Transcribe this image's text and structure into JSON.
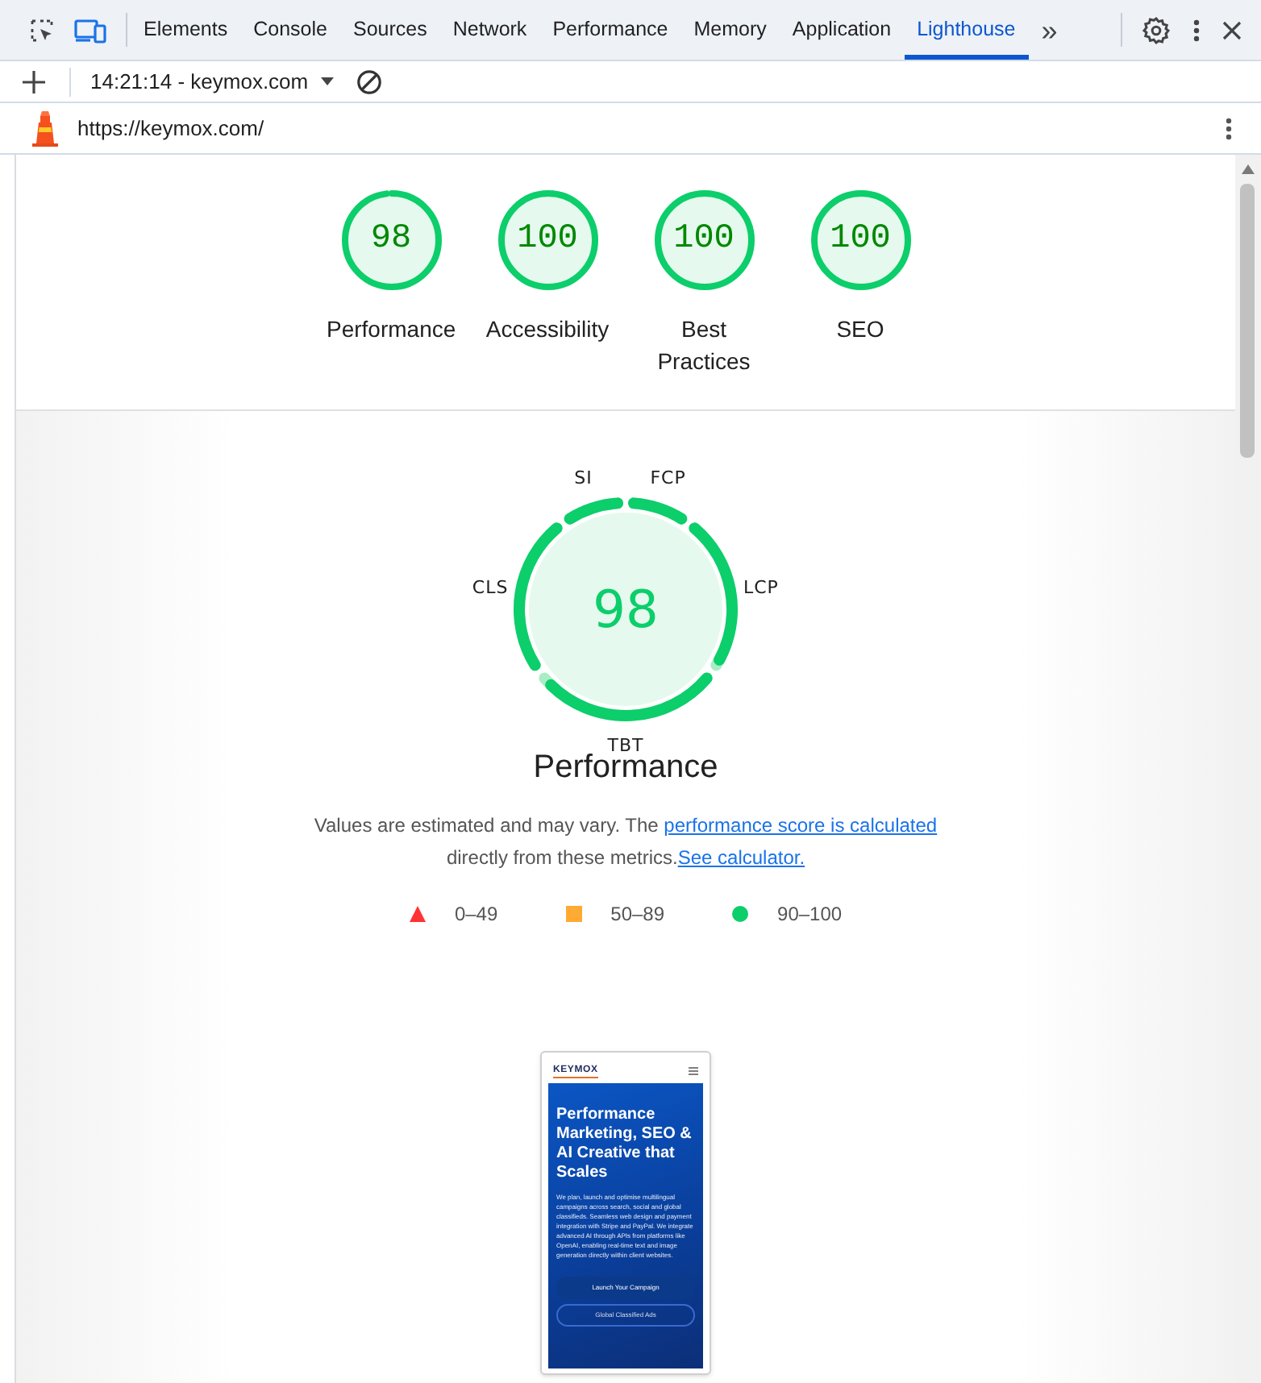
{
  "toolbar": {
    "tabs": [
      {
        "label": "Elements",
        "selected": false
      },
      {
        "label": "Console",
        "selected": false
      },
      {
        "label": "Sources",
        "selected": false
      },
      {
        "label": "Network",
        "selected": false
      },
      {
        "label": "Performance",
        "selected": false
      },
      {
        "label": "Memory",
        "selected": false
      },
      {
        "label": "Application",
        "selected": false
      },
      {
        "label": "Lighthouse",
        "selected": true
      }
    ],
    "more": "»"
  },
  "report_bar": {
    "report": "14:21:14 - keymox.com"
  },
  "url_bar": {
    "url": "https://keymox.com/"
  },
  "scores": [
    {
      "value": "98",
      "label": "Performance",
      "level": 0.98
    },
    {
      "value": "100",
      "label": "Accessibility",
      "level": 1
    },
    {
      "value": "100",
      "label": "Best Practices",
      "level": 1
    },
    {
      "value": "100",
      "label": "SEO",
      "level": 1
    }
  ],
  "gauge": {
    "score": "98",
    "title": "Performance",
    "metrics": [
      {
        "label": "FCP",
        "level": 1
      },
      {
        "label": "LCP",
        "level": 0.96
      },
      {
        "label": "TBT",
        "level": 0.95
      },
      {
        "label": "CLS",
        "level": 1
      },
      {
        "label": "SI",
        "level": 1
      }
    ]
  },
  "description": {
    "text_1": "Values are estimated and may vary. The ",
    "link_1": "performance score is calculated",
    "text_2": " directly from these metrics.",
    "link_2": "See calculator."
  },
  "legend": [
    {
      "kind": "fail",
      "range": "0–49"
    },
    {
      "kind": "average",
      "range": "50–89"
    },
    {
      "kind": "pass",
      "range": "90–100"
    }
  ],
  "screenshot": {
    "logo": "KEYMOX",
    "heading": "Performance Marketing, SEO & AI Creative that Scales",
    "paragraph": "We plan, launch and optimise multilingual campaigns across search, social and global classifieds. Seamless web design and payment integration with Stripe and PayPal. We integrate advanced AI through APIs from platforms like OpenAI, enabling real-time text and image generation directly within client websites.",
    "primary_button": "Launch Your Campaign",
    "secondary_button": "Global Classified Ads"
  }
}
